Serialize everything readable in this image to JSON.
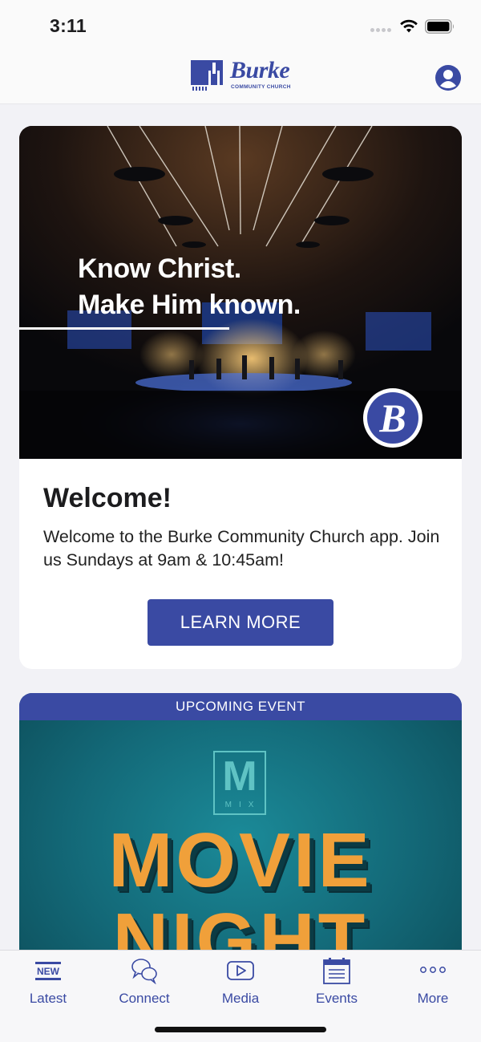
{
  "status_bar": {
    "time": "3:11"
  },
  "header": {
    "logo_word": "Burke",
    "logo_sub": "COMMUNITY CHURCH",
    "profile_icon": "person-circle-icon"
  },
  "welcome_card": {
    "hero_line1": "Know Christ.",
    "hero_line2": "Make Him known.",
    "badge_letter": "B",
    "title": "Welcome!",
    "body": "Welcome to the Burke Community Church app. Join us Sundays at 9am & 10:45am!",
    "button_label": "LEARN MORE"
  },
  "event_card": {
    "label": "UPCOMING EVENT",
    "logo_letter": "M",
    "logo_sub": "MIX",
    "art_line1": "MOVIE",
    "art_line2": "NIGHT"
  },
  "tabs": [
    {
      "label": "Latest",
      "icon": "new-badge-icon",
      "badge_text": "NEW"
    },
    {
      "label": "Connect",
      "icon": "chat-bubbles-icon"
    },
    {
      "label": "Media",
      "icon": "play-video-icon"
    },
    {
      "label": "Events",
      "icon": "calendar-icon"
    },
    {
      "label": "More",
      "icon": "more-dots-icon"
    }
  ],
  "colors": {
    "brand": "#3a4aa3",
    "background": "#f2f2f6"
  }
}
